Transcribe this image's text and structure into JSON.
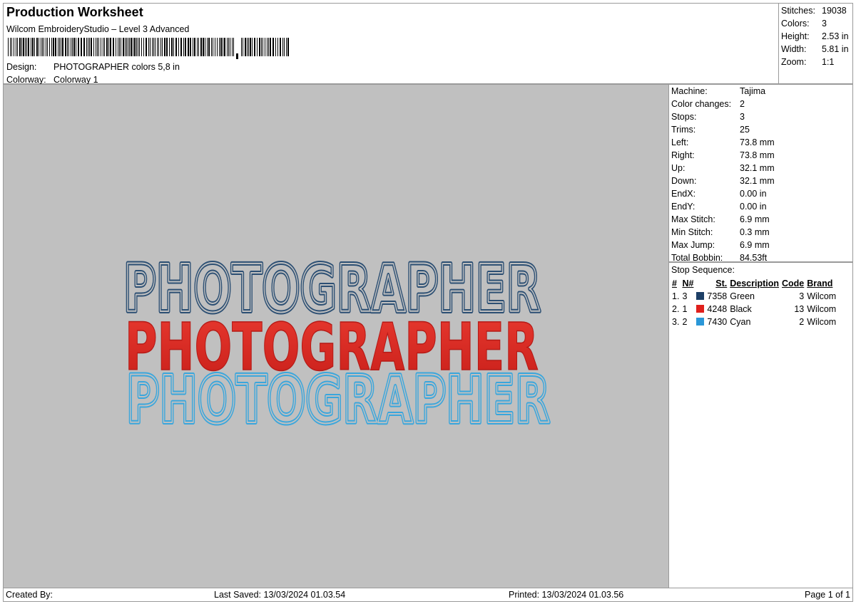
{
  "header": {
    "title": "Production Worksheet",
    "subtitle": "Wilcom EmbroideryStudio – Level 3 Advanced",
    "design_label": "Design:",
    "design_value": "PHOTOGRAPHER colors 5,8 in",
    "colorway_label": "Colorway:",
    "colorway_value": "Colorway 1"
  },
  "stats": [
    {
      "label": "Stitches:",
      "value": "19038"
    },
    {
      "label": "Colors:",
      "value": "3"
    },
    {
      "label": "Height:",
      "value": "2.53 in"
    },
    {
      "label": "Width:",
      "value": "5.81 in"
    },
    {
      "label": "Zoom:",
      "value": "1:1"
    }
  ],
  "machine": [
    {
      "label": "Machine:",
      "value": "Tajima"
    },
    {
      "label": "Color changes:",
      "value": "2"
    },
    {
      "label": "Stops:",
      "value": "3"
    },
    {
      "label": "Trims:",
      "value": "25"
    },
    {
      "label": "Left:",
      "value": "73.8 mm"
    },
    {
      "label": "Right:",
      "value": "73.8 mm"
    },
    {
      "label": "Up:",
      "value": "32.1 mm"
    },
    {
      "label": "Down:",
      "value": "32.1 mm"
    },
    {
      "label": "EndX:",
      "value": "0.00 in"
    },
    {
      "label": "EndY:",
      "value": "0.00 in"
    },
    {
      "label": "Max Stitch:",
      "value": "6.9 mm"
    },
    {
      "label": "Min Stitch:",
      "value": "0.3 mm"
    },
    {
      "label": "Max Jump:",
      "value": "6.9 mm"
    },
    {
      "label": "Total Bobbin:",
      "value": "84.53ft"
    }
  ],
  "stop_sequence": {
    "title": "Stop Sequence:",
    "headers": {
      "index": "#",
      "needle": "N#",
      "stitch": "St.",
      "description": "Description",
      "code": "Code",
      "brand": "Brand"
    },
    "rows": [
      {
        "index": "1.",
        "needle": "3",
        "color": "#1d3f66",
        "stitch": "7358",
        "description": "Green",
        "code": "3",
        "brand": "Wilcom"
      },
      {
        "index": "2.",
        "needle": "1",
        "color": "#e0201c",
        "stitch": "4248",
        "description": "Black",
        "code": "13",
        "brand": "Wilcom"
      },
      {
        "index": "3.",
        "needle": "2",
        "color": "#2a97d8",
        "stitch": "7430",
        "description": "Cyan",
        "code": "2",
        "brand": "Wilcom"
      }
    ]
  },
  "preview": {
    "background": "#c0c0c0",
    "design_text": "PHOTOGRAPHER",
    "colors": {
      "outline_top": "#2c4f73",
      "fill_middle": "#e2302b",
      "outline_bottom": "#3aa6dc"
    }
  },
  "footer": {
    "created_by": "Created By:",
    "last_saved": "Last Saved: 13/03/2024 01.03.54",
    "printed": "Printed: 13/03/2024 01.03.56",
    "page": "Page 1 of 1"
  }
}
